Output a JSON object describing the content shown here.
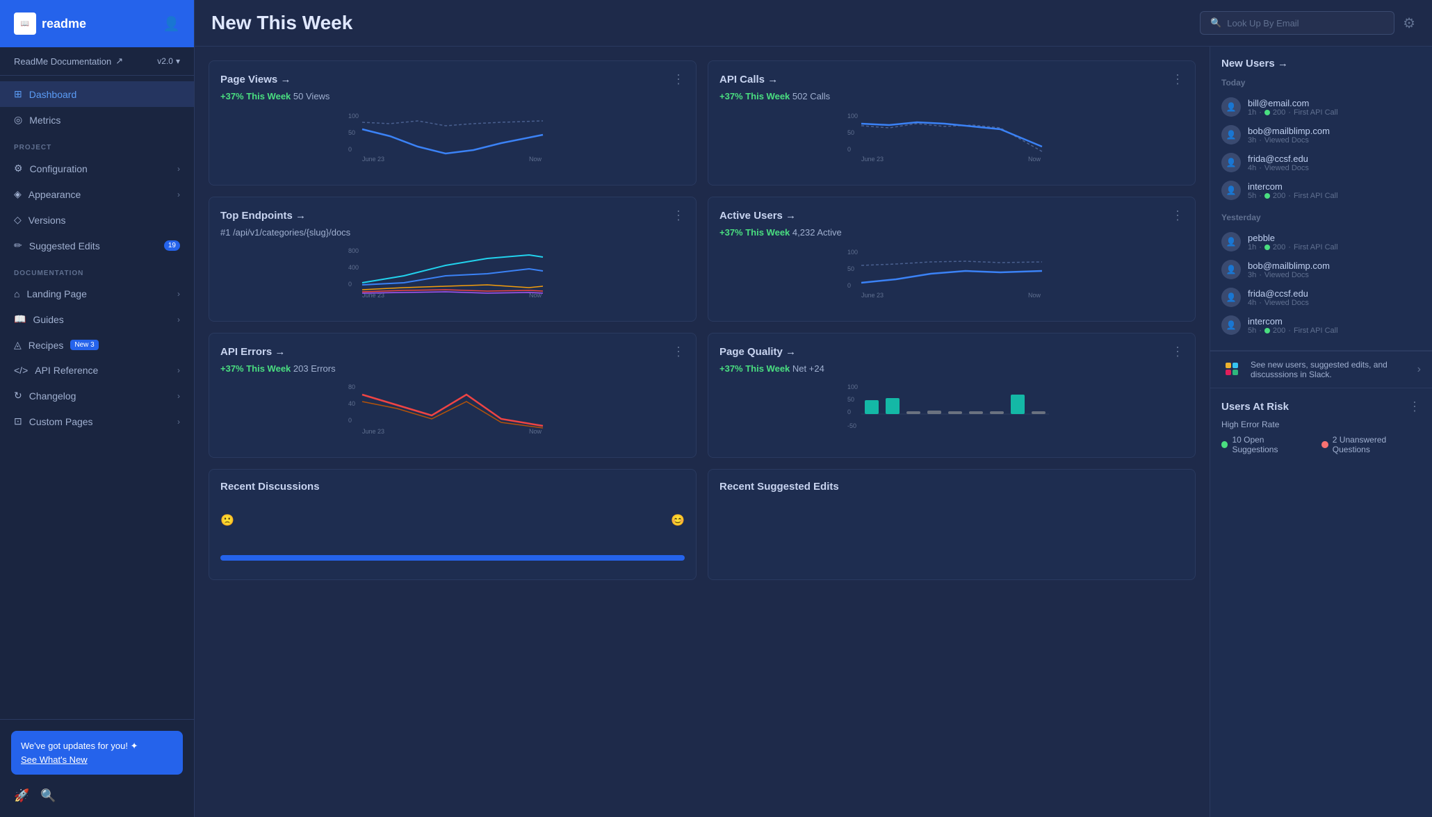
{
  "sidebar": {
    "logo": "readme",
    "project": "ReadMe Documentation",
    "project_icon": "↗",
    "version": "v2.0",
    "version_arrow": "▾",
    "nav": {
      "main_items": [
        {
          "id": "dashboard",
          "label": "Dashboard",
          "icon": "⊞",
          "active": true
        },
        {
          "id": "metrics",
          "label": "Metrics",
          "icon": "◎",
          "active": false
        }
      ],
      "project_section": "PROJECT",
      "project_items": [
        {
          "id": "configuration",
          "label": "Configuration",
          "icon": "⚙",
          "arrow": true
        },
        {
          "id": "appearance",
          "label": "Appearance",
          "icon": "◈",
          "arrow": true
        },
        {
          "id": "versions",
          "label": "Versions",
          "icon": "◇",
          "arrow": false
        },
        {
          "id": "suggested-edits",
          "label": "Suggested Edits",
          "icon": "✏",
          "badge": "19",
          "arrow": false
        }
      ],
      "documentation_section": "DOCUMENTATION",
      "documentation_items": [
        {
          "id": "landing-page",
          "label": "Landing Page",
          "icon": "⌂",
          "arrow": true
        },
        {
          "id": "guides",
          "label": "Guides",
          "icon": "📖",
          "arrow": true
        },
        {
          "id": "recipes",
          "label": "Recipes",
          "icon": "◬",
          "badge_new": "New 3",
          "arrow": false
        },
        {
          "id": "api-reference",
          "label": "API Reference",
          "icon": "<>",
          "arrow": true
        },
        {
          "id": "changelog",
          "label": "Changelog",
          "icon": "↻",
          "arrow": true
        },
        {
          "id": "custom-pages",
          "label": "Custom Pages",
          "icon": "⊡",
          "arrow": true
        }
      ]
    },
    "updates_banner": {
      "main_text": "We've got updates for you! ✦",
      "link_text": "See What's New"
    },
    "bottom_icons": [
      "🚀",
      "🔍"
    ]
  },
  "topbar": {
    "title": "New This Week",
    "search_placeholder": "Look Up By Email",
    "settings_icon": "⚙"
  },
  "charts": {
    "row1": [
      {
        "id": "page-views",
        "title": "Page Views →",
        "stat_up": "+37% This Week",
        "stat_value": "50 Views",
        "chart_type": "line_blue"
      },
      {
        "id": "api-calls",
        "title": "API Calls →",
        "stat_up": "+37% This Week",
        "stat_value": "502 Calls",
        "chart_type": "line_blue"
      }
    ],
    "row2": [
      {
        "id": "top-endpoints",
        "title": "Top Endpoints →",
        "stat_value": "#1 /api/v1/categories/{slug}/docs",
        "chart_type": "multi_line"
      },
      {
        "id": "active-users",
        "title": "Active Users →",
        "stat_up": "+37% This Week",
        "stat_value": "4,232 Active",
        "chart_type": "line_blue"
      }
    ],
    "row3": [
      {
        "id": "api-errors",
        "title": "API Errors →",
        "stat_up": "+37% This Week",
        "stat_value": "203 Errors",
        "chart_type": "line_red"
      },
      {
        "id": "page-quality",
        "title": "Page Quality →",
        "stat_up": "+37% This Week",
        "stat_value": "Net +24",
        "chart_type": "bar_teal"
      }
    ],
    "x_label_start": "June 23",
    "x_label_end": "Now"
  },
  "right_panel": {
    "title": "New Users →",
    "today_label": "Today",
    "today_users": [
      {
        "email": "bill@email.com",
        "time": "1h",
        "has_dot": true,
        "dot_value": "200",
        "action": "First API Call"
      },
      {
        "email": "bob@mailblimp.com",
        "time": "3h",
        "has_dot": false,
        "action": "Viewed Docs"
      },
      {
        "email": "frida@ccsf.edu",
        "time": "4h",
        "has_dot": false,
        "action": "Viewed Docs"
      },
      {
        "email": "intercom",
        "time": "5h",
        "has_dot": true,
        "dot_value": "200",
        "action": "First API Call"
      }
    ],
    "yesterday_label": "Yesterday",
    "yesterday_users": [
      {
        "email": "pebble",
        "time": "1h",
        "has_dot": true,
        "dot_value": "200",
        "action": "First API Call"
      },
      {
        "email": "bob@mailblimp.com",
        "time": "3h",
        "has_dot": false,
        "action": "Viewed Docs"
      },
      {
        "email": "frida@ccsf.edu",
        "time": "4h",
        "has_dot": false,
        "action": "Viewed Docs"
      },
      {
        "email": "intercom",
        "time": "5h",
        "has_dot": true,
        "dot_value": "200",
        "action": "First API Call"
      }
    ],
    "slack_text": "See new users, suggested edits, and discusssions in Slack."
  },
  "bottom": {
    "recent_discussions": {
      "title": "Recent Discussions"
    },
    "recent_suggested_edits": {
      "title": "Recent Suggested Edits"
    },
    "users_at_risk": {
      "title": "Users At Risk",
      "sub_label": "High Error Rate",
      "open_suggestions": "10 Open Suggestions",
      "unanswered": "2 Unanswered Questions"
    }
  }
}
